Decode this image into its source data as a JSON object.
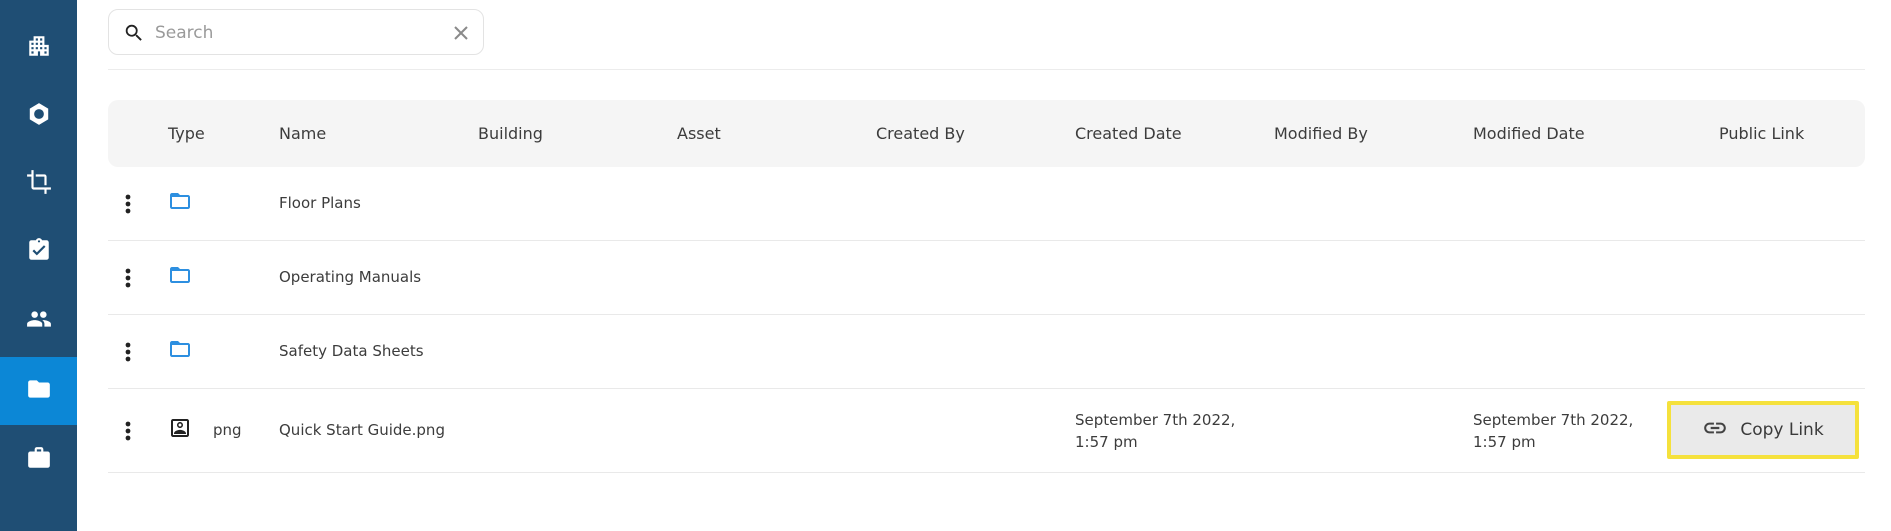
{
  "sidebar": {
    "items": [
      {
        "icon": "building-icon",
        "active": false
      },
      {
        "icon": "hexagon-icon",
        "active": false
      },
      {
        "icon": "crop-icon",
        "active": false
      },
      {
        "icon": "clipboard-check-icon",
        "active": false
      },
      {
        "icon": "people-icon",
        "active": false
      },
      {
        "icon": "folder-icon",
        "active": true
      },
      {
        "icon": "briefcase-icon",
        "active": false
      }
    ],
    "colors": {
      "background": "#1f4e74",
      "active": "#0c87d6"
    }
  },
  "search": {
    "placeholder": "Search",
    "value": ""
  },
  "table": {
    "columns": [
      "",
      "Type",
      "Name",
      "Building",
      "Asset",
      "Created By",
      "Created Date",
      "Modified By",
      "Modified Date",
      "Public Link"
    ],
    "rows": [
      {
        "kind": "folder",
        "type_label": "",
        "name": "Floor Plans",
        "building": "",
        "asset": "",
        "created_by": "",
        "created_date": "",
        "modified_by": "",
        "modified_date": "",
        "public_link": ""
      },
      {
        "kind": "folder",
        "type_label": "",
        "name": "Operating Manuals",
        "building": "",
        "asset": "",
        "created_by": "",
        "created_date": "",
        "modified_by": "",
        "modified_date": "",
        "public_link": ""
      },
      {
        "kind": "folder",
        "type_label": "",
        "name": "Safety Data Sheets",
        "building": "",
        "asset": "",
        "created_by": "",
        "created_date": "",
        "modified_by": "",
        "modified_date": "",
        "public_link": ""
      },
      {
        "kind": "file",
        "type_label": "png",
        "name": "Quick Start Guide.png",
        "building": "",
        "asset": "",
        "created_by": "",
        "created_date": "September 7th 2022, 1:57 pm",
        "modified_by": "",
        "modified_date": "September 7th 2022, 1:57 pm",
        "public_link": "Copy Link"
      }
    ],
    "colors": {
      "folder_icon": "#2d8fe0",
      "header_bg": "#f5f5f5",
      "highlight_border": "#f5e13c"
    }
  }
}
